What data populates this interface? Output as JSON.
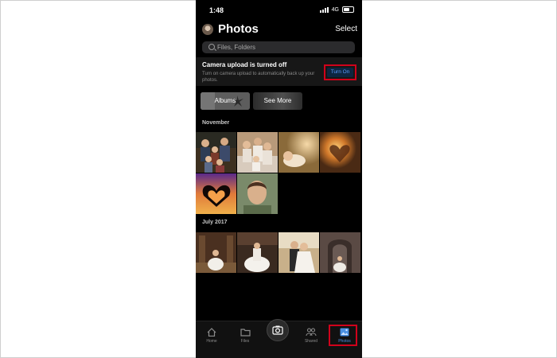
{
  "status_bar": {
    "time": "1:48",
    "network": "4G"
  },
  "header": {
    "title": "Photos",
    "select_label": "Select"
  },
  "search": {
    "placeholder": "Files, Folders"
  },
  "banner": {
    "title": "Camera upload is turned off",
    "description": "Turn on camera upload to automatically back up your photos.",
    "button_label": "Turn On"
  },
  "chips": {
    "albums_label": "Albums",
    "see_more_label": "See More"
  },
  "sections": [
    {
      "label": "November",
      "photo_count": 6
    },
    {
      "label": "July 2017",
      "photo_count": 4
    }
  ],
  "tabbar": {
    "items": [
      {
        "label": "Home",
        "icon": "home-icon"
      },
      {
        "label": "Files",
        "icon": "folder-icon"
      },
      {
        "label": "",
        "icon": "camera-icon"
      },
      {
        "label": "Shared",
        "icon": "people-icon"
      },
      {
        "label": "Photos",
        "icon": "photo-icon",
        "active": true
      }
    ]
  },
  "colors": {
    "accent": "#4a90e2",
    "highlight_box": "#d0021b",
    "background": "#000000"
  }
}
